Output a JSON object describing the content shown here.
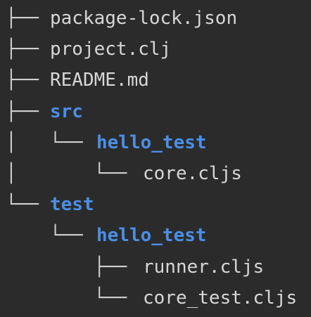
{
  "tree": {
    "entries": [
      {
        "prefix": "├── ",
        "name": "package-lock.json",
        "type": "file"
      },
      {
        "prefix": "├── ",
        "name": "project.clj",
        "type": "file"
      },
      {
        "prefix": "├── ",
        "name": "README.md",
        "type": "file"
      },
      {
        "prefix": "├── ",
        "name": "src",
        "type": "directory"
      },
      {
        "prefix": "│   └── ",
        "name": "hello_test",
        "type": "directory"
      },
      {
        "prefix": "│       └── ",
        "name": "core.cljs",
        "type": "file"
      },
      {
        "prefix": "└── ",
        "name": "test",
        "type": "directory"
      },
      {
        "prefix": "    └── ",
        "name": "hello_test",
        "type": "directory"
      },
      {
        "prefix": "        ├── ",
        "name": "runner.cljs",
        "type": "file"
      },
      {
        "prefix": "        └── ",
        "name": "core_test.cljs",
        "type": "file"
      }
    ]
  },
  "colors": {
    "background": "#2b2b2b",
    "text": "#d7d7d7",
    "directory": "#4a8fe7"
  }
}
